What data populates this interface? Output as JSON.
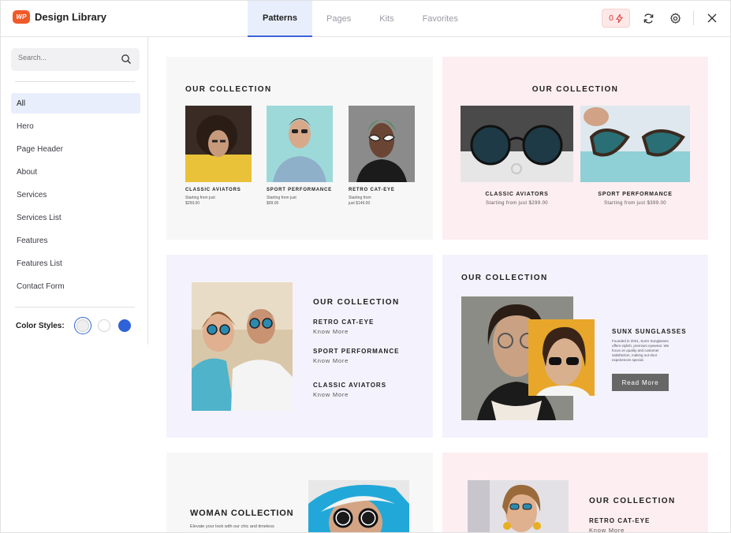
{
  "app": {
    "logo_text": "WP",
    "title": "Design Library"
  },
  "tabs": [
    {
      "label": "Patterns",
      "active": true
    },
    {
      "label": "Pages",
      "active": false
    },
    {
      "label": "Kits",
      "active": false
    },
    {
      "label": "Favorites",
      "active": false
    }
  ],
  "header": {
    "credits_count": "0",
    "icons": [
      "lightning-icon",
      "refresh-icon",
      "gear-icon",
      "close-icon"
    ]
  },
  "sidebar": {
    "search_placeholder": "Search...",
    "items": [
      {
        "label": "All",
        "active": true
      },
      {
        "label": "Hero"
      },
      {
        "label": "Page Header"
      },
      {
        "label": "About"
      },
      {
        "label": "Services"
      },
      {
        "label": "Services List"
      },
      {
        "label": "Features"
      },
      {
        "label": "Features List"
      },
      {
        "label": "Contact Form"
      }
    ],
    "color_styles_label": "Color Styles:",
    "swatches": [
      "#eeeeee",
      "#ffffff",
      "#2f62d8"
    ]
  },
  "cards": {
    "c1": {
      "title": "OUR COLLECTION",
      "products": [
        {
          "name": "CLASSIC AVIATORS",
          "line1": "Starting from just",
          "line2": "$299.00"
        },
        {
          "name": "SPORT PERFORMANCE",
          "line1": "Starting from just",
          "line2": "$99.00"
        },
        {
          "name": "RETRO CAT-EYE",
          "line1": "Starting from",
          "line2": "just $149.00"
        }
      ]
    },
    "c2": {
      "title": "OUR COLLECTION",
      "products": [
        {
          "name": "CLASSIC AVIATORS",
          "price": "Starting from just $299.00"
        },
        {
          "name": "SPORT PERFORMANCE",
          "price": "Starting from just $399.00"
        }
      ]
    },
    "c3": {
      "title": "OUR COLLECTION",
      "items": [
        {
          "name": "RETRO CAT-EYE",
          "link": "Know More"
        },
        {
          "name": "SPORT PERFORMANCE",
          "link": "Know More"
        },
        {
          "name": "CLASSIC AVIATORS",
          "link": "Know More"
        }
      ]
    },
    "c4": {
      "title": "OUR COLLECTION",
      "heading": "SUNX SUNGLASSES",
      "desc": "Founded in 2021, SunX Sunglasses offers stylish, premium eyewear. We focus on quality and customer satisfaction, making out door experiences special.",
      "button": "Read More"
    },
    "c5": {
      "title": "WOMAN COLLECTION",
      "desc": "Elevate your look with our chic and timeless"
    },
    "c6": {
      "title": "OUR COLLECTION",
      "item": "RETRO CAT-EYE",
      "link": "Know More"
    }
  }
}
